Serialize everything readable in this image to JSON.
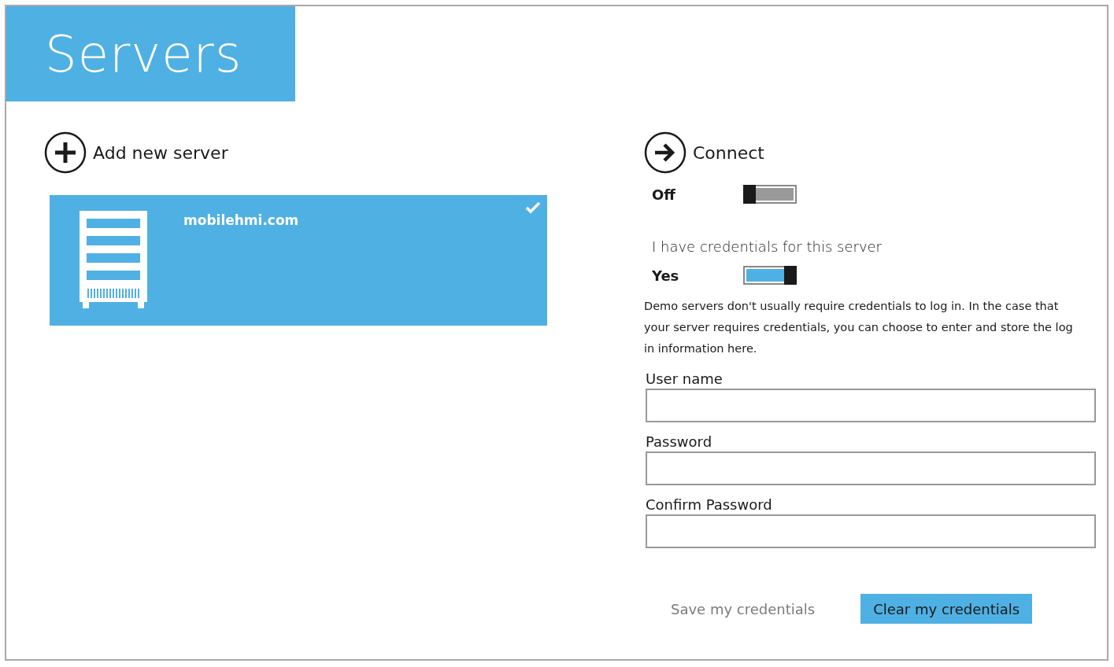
{
  "header": {
    "title": "Servers"
  },
  "add_server": {
    "label": "Add new server"
  },
  "servers": [
    {
      "name": "mobilehmi.com",
      "selected": true
    }
  ],
  "connect": {
    "label": "Connect"
  },
  "connection_toggle": {
    "label": "Off",
    "on": false
  },
  "credentials_heading": "I have credentials for this server",
  "credentials_toggle": {
    "label": "Yes",
    "on": true
  },
  "help_text": "Demo servers don't usually require credentials to log in. In the case that your server requires credentials, you can choose to enter and store the log in information here.",
  "fields": [
    {
      "label": "User name"
    },
    {
      "label": "Password"
    },
    {
      "label": "Confirm Password"
    }
  ],
  "buttons": [
    {
      "label": "Save my credentials",
      "disabled": true,
      "kind": "plain"
    },
    {
      "label": "Clear my credentials",
      "disabled": false,
      "kind": "accent"
    }
  ]
}
